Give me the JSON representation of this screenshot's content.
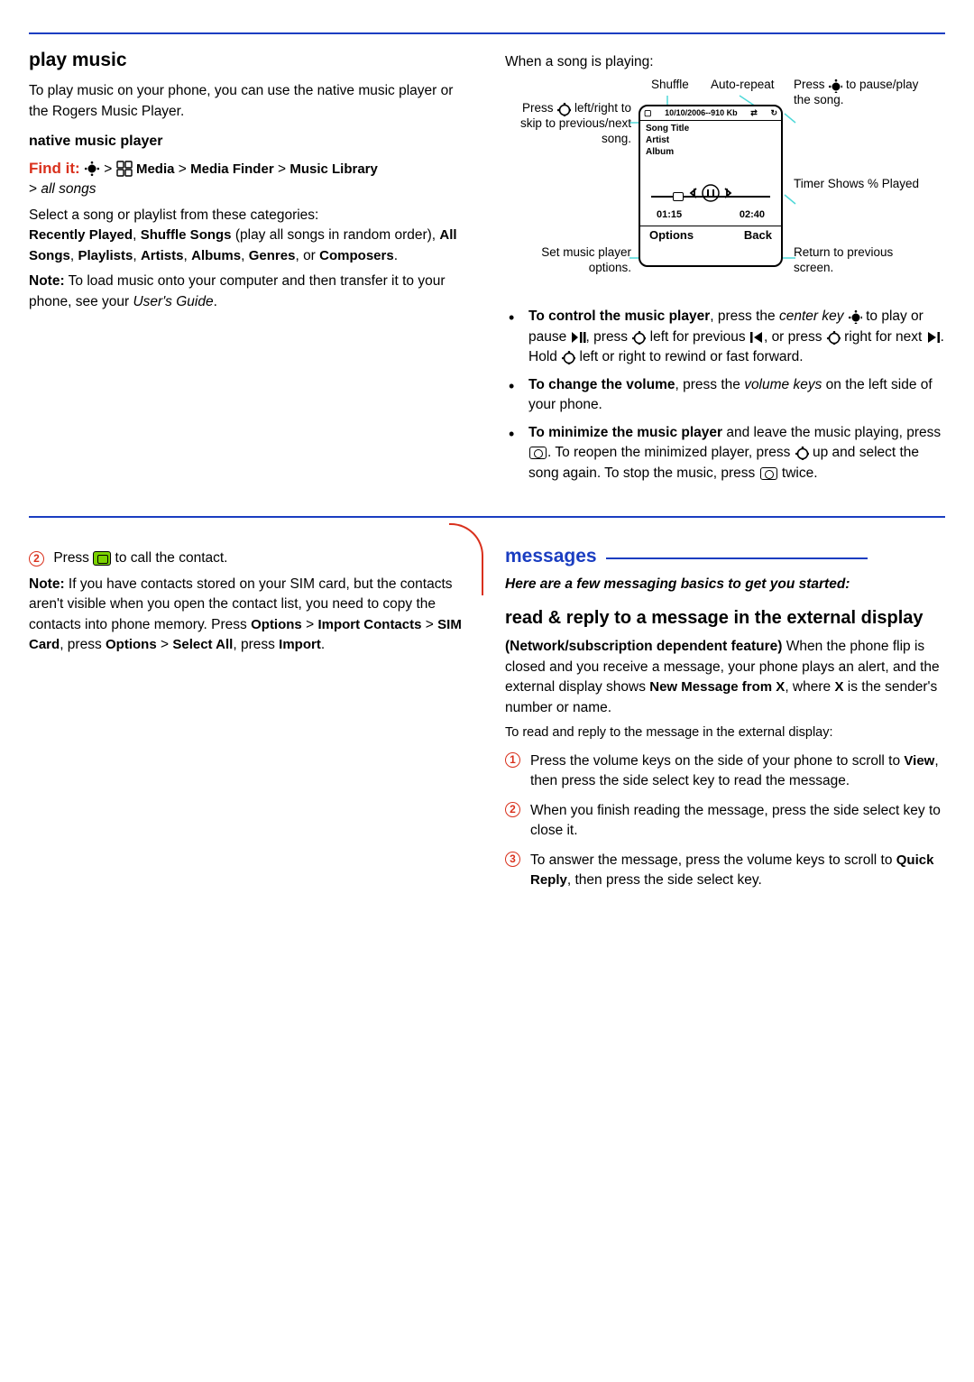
{
  "top": {
    "left": {
      "heading": "play music",
      "intro": "To play music on your phone, you can use the native music player or the Rogers Music Player.",
      "sub": "native music player",
      "findit_label": "Find it:",
      "findit_path1": "Media",
      "findit_path2": "Media Finder",
      "findit_path3": "Music Library",
      "allsongs": "all songs",
      "select_intro": "Select a song or playlist from these categories:",
      "cat_recent": "Recently Played",
      "cat_shuffle": "Shuffle Songs",
      "cat_shuffle_paren": " (play all songs in random order), ",
      "cat_all": "All Songs",
      "cat_playlists": "Playlists",
      "cat_artists": "Artists",
      "cat_albums": "Albums",
      "cat_genres": "Genres",
      "cat_or": ", or ",
      "cat_composers": "Composers",
      "note_label": "Note:",
      "note_text": " To load music onto your computer and then transfer it to your phone, see your ",
      "note_ital": "User's Guide"
    },
    "right": {
      "lead": "When a song is playing:",
      "callouts": {
        "shuffle": "Shuffle",
        "autorepeat": "Auto-repeat",
        "press_left_right": "Press ",
        "press_lr_2": " left/right to skip to previous/next song.",
        "press_center": "Press ",
        "press_center_2": " to pause/play the song.",
        "timer": "Timer Shows % Played",
        "set_opts": "Set music player options.",
        "return_prev": "Return to previous screen."
      },
      "screen": {
        "status_folder": "10/10/2006--910 Kb",
        "song_title": "Song Title",
        "artist": "Artist",
        "album": "Album",
        "t_elapsed": "01:15",
        "t_total": "02:40",
        "sk_left": "Options",
        "sk_right": "Back"
      },
      "b1_a": "To control the music player",
      "b1_b": ", press the ",
      "b1_center": "center key",
      "b1_c": " to play or pause ",
      "b1_d": ", press ",
      "b1_e": " left for previous ",
      "b1_f": ", or press ",
      "b1_g": " right for next ",
      "b1_h": ". Hold ",
      "b1_i": " left or right to rewind or fast forward.",
      "b2_a": "To change the volume",
      "b2_b": ", press the ",
      "b2_vol": "volume keys",
      "b2_c": " on the left side of your phone.",
      "b3_a": "To minimize the music player",
      "b3_b": " and leave the music playing, press ",
      "b3_c": ". To reopen the minimized player, press ",
      "b3_d": " up and select the song again. To stop the music, press ",
      "b3_e": " twice."
    }
  },
  "lower": {
    "left": {
      "step2_a": "Press ",
      "step2_b": " to call the contact.",
      "note_label": "Note:",
      "note_body": " If you have contacts stored on your SIM card, but the contacts aren't visible when you open the contact list, you need to copy the contacts into phone memory. Press ",
      "path1": "Options",
      "gt": " > ",
      "path2": "Import Contacts",
      "path3": "SIM Card",
      "press2": ", press ",
      "path4": "Options",
      "path5": "Select All",
      "press3": ", press ",
      "path6": "Import"
    },
    "right": {
      "title": "messages",
      "sub_ital": "Here are a few messaging basics to get you started:",
      "h3": "read & reply to a message in the external display",
      "p1_bold": "(Network/subscription dependent feature)",
      "p1_a": " When the phone flip is closed and you receive a message, your phone plays an alert, and the external display shows ",
      "p1_cond": "New Message from X",
      "p1_b": ", where ",
      "p1_x": "X",
      "p1_c": " is the sender's number or name.",
      "lead2": "To read and reply to the message in the external display:",
      "s1_a": "Press the volume keys on the side of your phone to scroll to ",
      "s1_view": "View",
      "s1_b": ", then press the side select key to read the message.",
      "s2": "When you finish reading the message, press the side select key to close it.",
      "s3_a": "To answer the message, press the volume keys to scroll to ",
      "s3_qr": "Quick Reply",
      "s3_b": ", then press the side select key."
    }
  }
}
